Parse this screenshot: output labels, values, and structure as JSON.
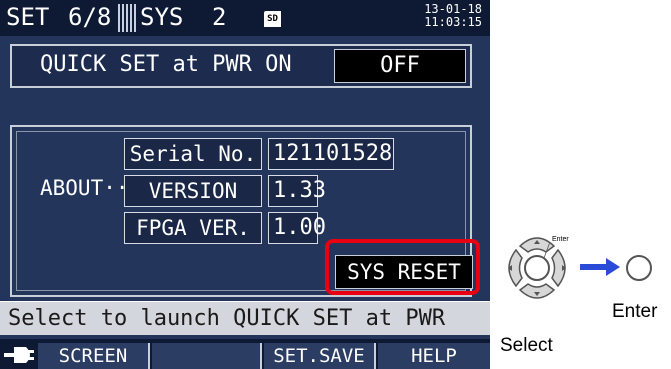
{
  "status_bar": {
    "set_label": "SET",
    "page": "6/8",
    "sys_label": "SYS",
    "sys_number": "2",
    "sd_label": "SD",
    "date": "13-01-18",
    "time": "11:03:15"
  },
  "quick_set": {
    "label": "QUICK SET at PWR ON",
    "value": "OFF"
  },
  "about": {
    "label": "ABOUT···",
    "serial_label": "Serial No.",
    "serial_value": "121101528",
    "version_label": "VERSION",
    "version_value": "1.33",
    "fpga_label": "FPGA VER.",
    "fpga_value": "1.00"
  },
  "sys_reset_label": "SYS RESET",
  "help_message": "Select to launch QUICK SET at PWR ON.",
  "function_keys": {
    "screen": "SCREEN",
    "empty": "",
    "set_save": "SET.SAVE",
    "help": "HELP"
  },
  "instructions": {
    "select_label": "Select",
    "enter_label": "Enter",
    "enter_small": "Enter"
  },
  "colors": {
    "screen_bg": "#23355a",
    "highlight": "#e60012",
    "arrow": "#2a4bd7"
  },
  "icons": [
    "plug-icon",
    "sd-card-icon",
    "dpad-icon",
    "arrow-right-icon",
    "enter-key-icon"
  ]
}
